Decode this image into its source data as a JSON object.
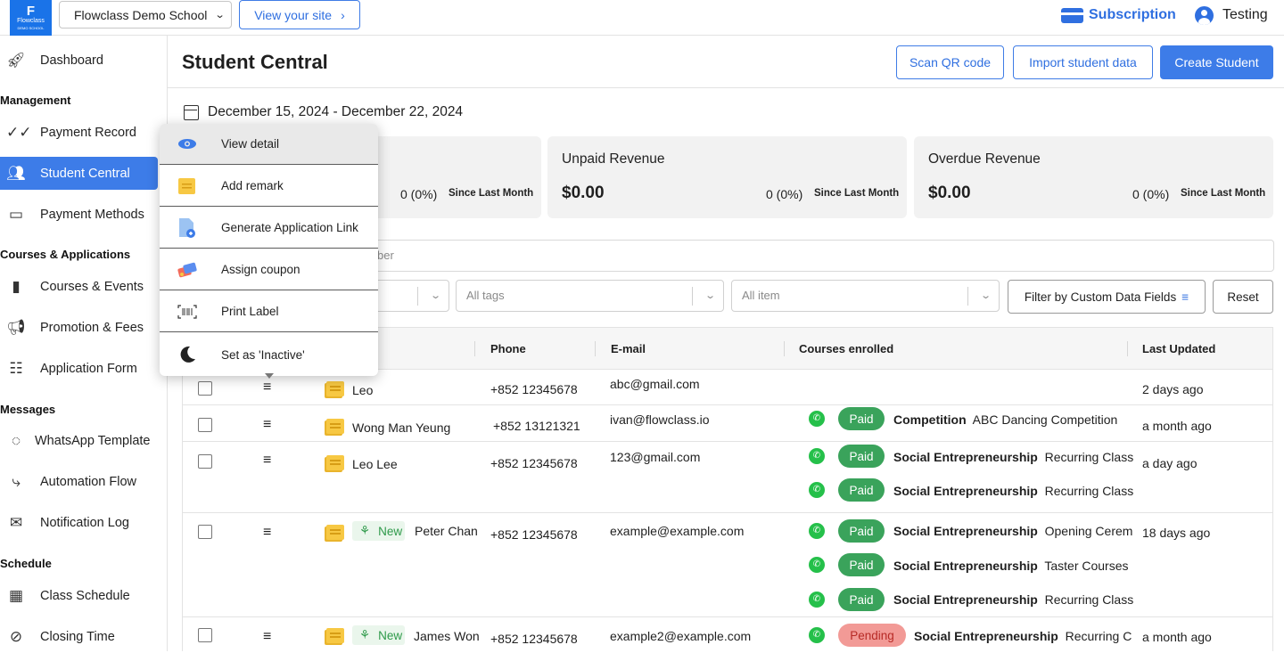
{
  "app": {
    "logo_text": "Flowclass",
    "logo_sub": "DEMO SCHOOL"
  },
  "topbar": {
    "school": "Flowclass Demo School",
    "view_site": "View your site",
    "subscription": "Subscription",
    "user": "Testing"
  },
  "sidebar": {
    "dashboard": "Dashboard",
    "sec_management": "Management",
    "payment_record": "Payment Record",
    "student_central": "Student Central",
    "payment_methods": "Payment Methods",
    "sec_courses": "Courses & Applications",
    "courses_events": "Courses & Events",
    "promotion_fees": "Promotion & Fees",
    "application_form": "Application Form",
    "sec_messages": "Messages",
    "whatsapp_template": "WhatsApp Template",
    "automation_flow": "Automation Flow",
    "notification_log": "Notification Log",
    "sec_schedule": "Schedule",
    "class_schedule": "Class Schedule",
    "closing_time": "Closing Time"
  },
  "header": {
    "title": "Student Central",
    "scan_qr": "Scan QR code",
    "import": "Import student data",
    "create": "Create Student"
  },
  "date_range": "December 15, 2024 - December 22, 2024",
  "cards": [
    {
      "label": "",
      "value": "",
      "pct": "0 (0%)",
      "since": "Since Last Month"
    },
    {
      "label": "Unpaid Revenue",
      "value": "$0.00",
      "pct": "0 (0%)",
      "since": "Since Last Month"
    },
    {
      "label": "Overdue Revenue",
      "value": "$0.00",
      "pct": "0 (0%)",
      "since": "Since Last Month"
    }
  ],
  "search": {
    "placeholder_visible": "ber"
  },
  "filters": {
    "tags": "All tags",
    "item": "All item",
    "custom": "Filter by Custom Data Fields",
    "reset": "Reset"
  },
  "table": {
    "columns": {
      "phone": "Phone",
      "email": "E-mail",
      "courses": "Courses enrolled",
      "updated": "Last Updated"
    },
    "new_label": "New",
    "rows": [
      {
        "name": "Leo",
        "phone": "+852 12345678",
        "email": "abc@gmail.com",
        "updated": "2 days ago"
      },
      {
        "name": "Wong Man Yeung",
        "phone": "+852 13121321",
        "email": "ivan@flowclass.io",
        "updated": "a month ago",
        "courses": [
          {
            "status": "Paid",
            "category": "Competition",
            "course": "ABC Dancing Competition"
          }
        ]
      },
      {
        "name": "Leo Lee",
        "phone": "+852 12345678",
        "email": "123@gmail.com",
        "updated": "a day ago",
        "courses": [
          {
            "status": "Paid",
            "category": "Social Entrepreneurship",
            "course": "Recurring Class"
          },
          {
            "status": "Paid",
            "category": "Social Entrepreneurship",
            "course": "Recurring Class"
          }
        ]
      },
      {
        "name": "Peter Chan",
        "phone": "+852 12345678",
        "email": "example@example.com",
        "updated": "18 days ago",
        "courses": [
          {
            "status": "Paid",
            "category": "Social Entrepreneurship",
            "course": "Opening Cerem"
          },
          {
            "status": "Paid",
            "category": "Social Entrepreneurship",
            "course": "Taster Courses"
          },
          {
            "status": "Paid",
            "category": "Social Entrepreneurship",
            "course": "Recurring Class"
          }
        ]
      },
      {
        "name": "James Won",
        "phone": "+852 12345678",
        "email": "example2@example.com",
        "updated": "a month ago",
        "courses": [
          {
            "status": "Pending",
            "category": "Social Entrepreneurship",
            "course": "Recurring C"
          }
        ]
      }
    ]
  },
  "context_menu": {
    "view_detail": "View detail",
    "add_remark": "Add remark",
    "generate_link": "Generate Application Link",
    "assign_coupon": "Assign coupon",
    "print_label": "Print Label",
    "set_inactive": "Set as 'Inactive'"
  },
  "colors": {
    "primary": "#3d7ce8",
    "paid": "#3aa35b",
    "pending_bg": "#f29a96",
    "whatsapp": "#25c04a"
  }
}
